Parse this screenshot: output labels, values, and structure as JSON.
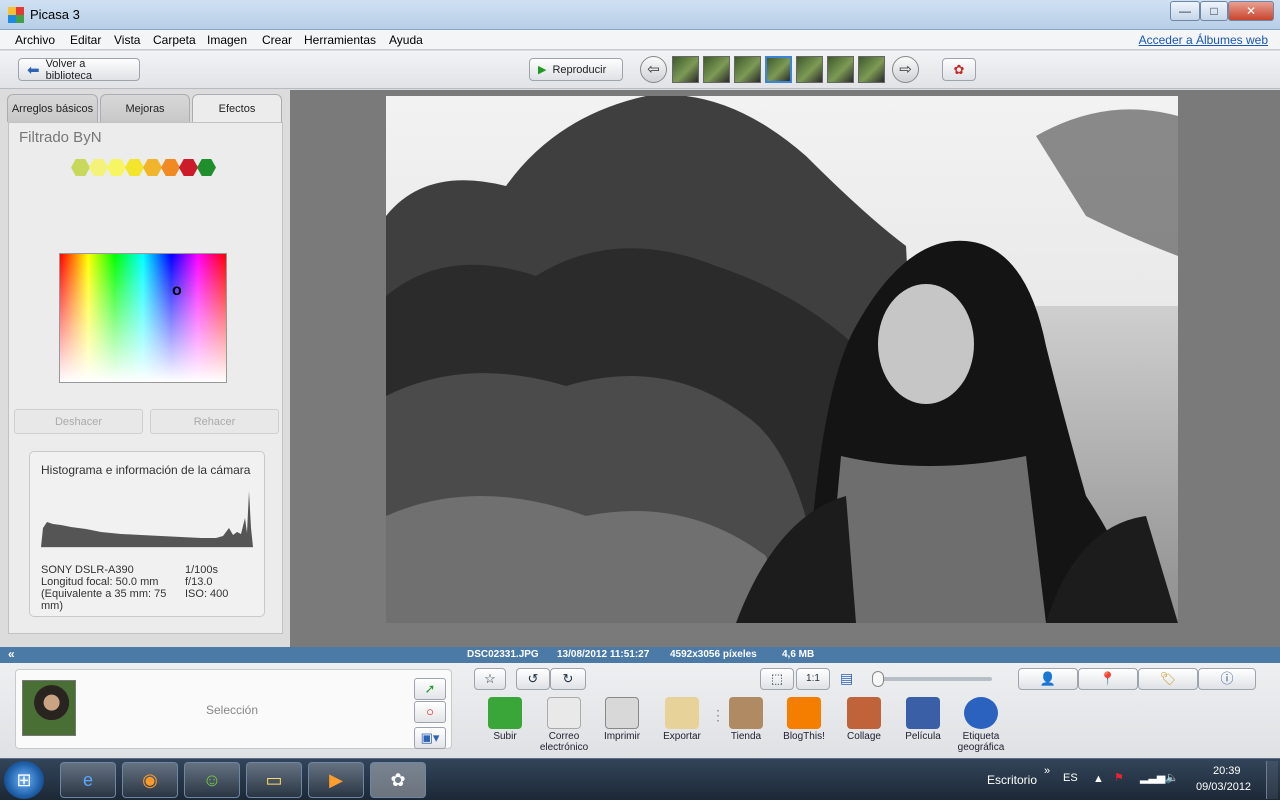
{
  "window": {
    "title": "Picasa 3",
    "min": "—",
    "max": "□",
    "close": "✕"
  },
  "menu": [
    "Archivo",
    "Editar",
    "Vista",
    "Carpeta",
    "Imagen",
    "Crear",
    "Herramientas",
    "Ayuda"
  ],
  "menu_link": "Acceder a Álbumes web",
  "toolbar": {
    "back": "Volver a biblioteca",
    "play": "Reproducir",
    "prev": "⇦",
    "next": "⇨"
  },
  "tabs": [
    "Arreglos básicos",
    "Mejoras",
    "Efectos"
  ],
  "effects": {
    "filter_title": "Filtrado ByN",
    "swatches": [
      "#c7d85a",
      "#f5f27a",
      "#f7f561",
      "#f2e52b",
      "#f0b52a",
      "#f08a22",
      "#cc1c2a",
      "#1f8f2e"
    ],
    "undo": "Deshacer",
    "redo": "Rehacer"
  },
  "histogram": {
    "title": "Histograma e información de la cámara",
    "camera_left": [
      "SONY  DSLR-A390",
      "Longitud focal: 50.0 mm",
      "(Equivalente a 35 mm:  75 mm)"
    ],
    "camera_right": [
      "1/100s",
      "f/13.0",
      "ISO: 400"
    ]
  },
  "status": {
    "collapse": "«",
    "file": "DSC02331.JPG",
    "date": "13/08/2012 11:51:27",
    "size_px": "4592x3056 píxeles",
    "size_mb": "4,6 MB"
  },
  "selection": {
    "label": "Selección"
  },
  "actions": [
    {
      "label": "Subir",
      "color": "#3aa63a"
    },
    {
      "label": "Correo electrónico",
      "color": "#e9e9e9"
    },
    {
      "label": "Imprimir",
      "color": "#d8d8d8"
    },
    {
      "label": "Exportar",
      "color": "#e7d39a"
    },
    {
      "label": "Tienda",
      "color": "#b08a62"
    },
    {
      "label": "BlogThis!",
      "color": "#f57d00"
    },
    {
      "label": "Collage",
      "color": "#c0633a"
    },
    {
      "label": "Película",
      "color": "#3a5fa6"
    },
    {
      "label": "Etiqueta geográfica",
      "color": "#2b62c0"
    }
  ],
  "taskbar": {
    "desktop": "Escritorio",
    "lang": "ES",
    "time": "20:39",
    "date": "09/03/2012"
  }
}
